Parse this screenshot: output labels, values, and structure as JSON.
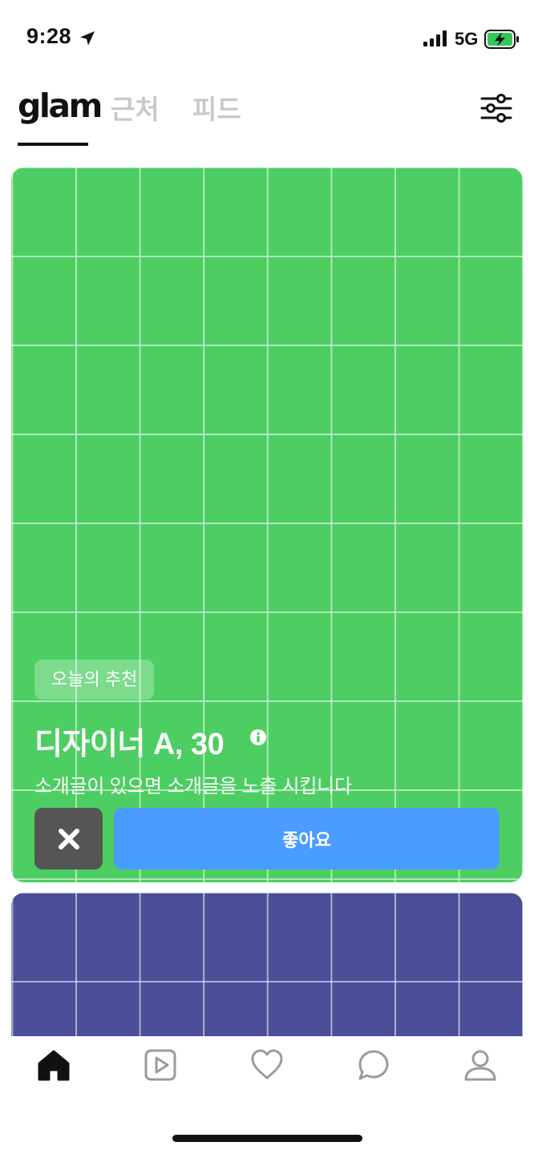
{
  "status_bar": {
    "time": "9:28",
    "network": "5G",
    "icons": [
      "location-arrow-icon",
      "signal-bars-icon",
      "battery-charging-icon"
    ]
  },
  "header": {
    "tabs": [
      {
        "label": "glam",
        "active": true
      },
      {
        "label": "근처",
        "active": false
      },
      {
        "label": "피드",
        "active": false
      }
    ],
    "filter_icon": "sliders-icon"
  },
  "colors": {
    "card_main_bg": "#4cce62",
    "card_next_bg": "#4b4e99",
    "like_button": "#4b9cff",
    "pass_button": "#555555",
    "inactive_tab": "#c9c9c9"
  },
  "card": {
    "badge": "오늘의 추천",
    "name": "디자이너 A, 30",
    "intro": "소개글이 있으면 소개글을 노출 시킵니다",
    "pass_icon": "close-icon",
    "like_label": "좋아요"
  },
  "bottom_nav": {
    "items": [
      {
        "icon": "home-icon",
        "active": true
      },
      {
        "icon": "play-icon",
        "active": false
      },
      {
        "icon": "heart-icon",
        "active": false
      },
      {
        "icon": "chat-icon",
        "active": false
      },
      {
        "icon": "profile-icon",
        "active": false
      }
    ]
  }
}
